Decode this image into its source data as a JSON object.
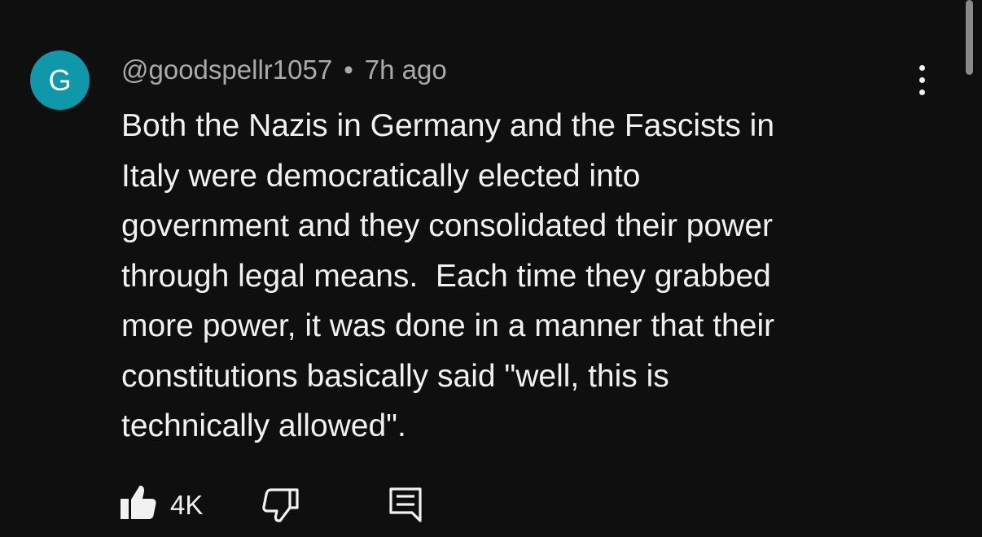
{
  "comment": {
    "avatar_initial": "G",
    "author": "@goodspellr1057",
    "separator": "•",
    "time_ago": "7h ago",
    "text": "Both the Nazis in Germany and the Fascists in\nItaly were democratically elected into\ngovernment and they consolidated their power\nthrough legal means.  Each time they grabbed\nmore power, it was done in a manner that their\nconstitutions basically said \"well, this is\ntechnically allowed\".",
    "like_count": "4K"
  },
  "icons": {
    "like": "thumbs-up-icon",
    "dislike": "thumbs-down-icon",
    "reply": "reply-comment-icon",
    "menu": "more-vert-icon"
  },
  "colors": {
    "background": "#0f0f0f",
    "avatar": "#0e98aa",
    "primary_text": "#f1f1f1",
    "secondary_text": "#aaaaaa"
  }
}
